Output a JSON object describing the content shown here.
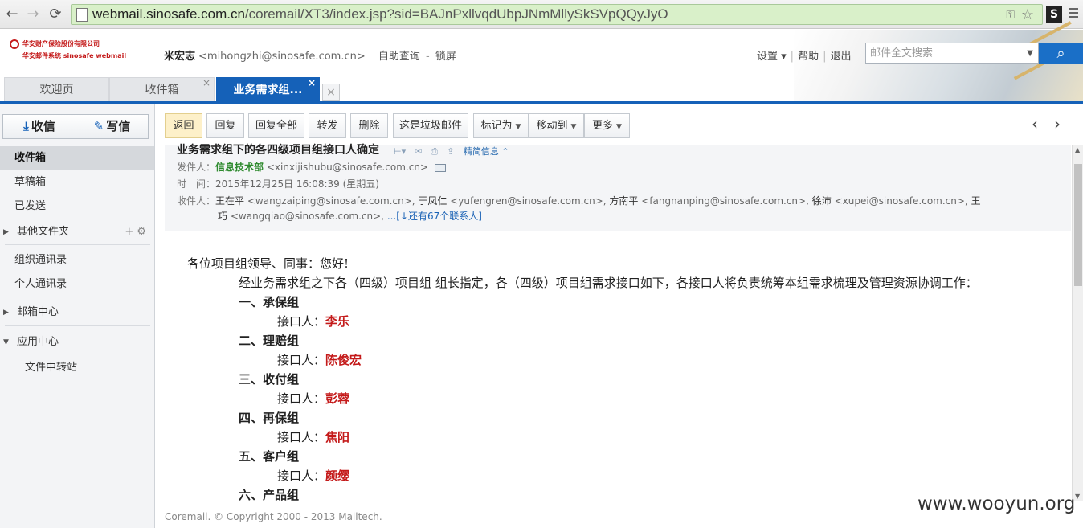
{
  "browser": {
    "url_host": "webmail.sinosafe.com.cn",
    "url_path": "/coremail/XT3/index.jsp?sid=BAJnPxllvqdUbpJNmMllySkSVpQQyJyO",
    "extension_label": "S"
  },
  "header": {
    "logo_line1": "华安财产保险股份有限公司",
    "logo_line2": "华安邮件系统  sinosafe webmail",
    "user_name": "米宏志",
    "user_email": "<mihongzhi@sinosafe.com.cn>",
    "links": [
      "自助查询",
      "锁屏"
    ],
    "link_sep": "-",
    "settings": "设置 ▾",
    "help": "帮助",
    "logout": "退出",
    "search_placeholder": "邮件全文搜索"
  },
  "tabs": [
    {
      "label": "欢迎页"
    },
    {
      "label": "收件箱",
      "close": "×"
    },
    {
      "label": "业务需求组...",
      "close": "×"
    }
  ],
  "tab_close_all": "×",
  "sidebar": {
    "receive": "收信",
    "compose": "写信",
    "items": [
      {
        "label": "收件箱"
      },
      {
        "label": "草稿箱"
      },
      {
        "label": "已发送"
      },
      {
        "label": "其他文件夹"
      },
      {
        "label": "组织通讯录"
      },
      {
        "label": "个人通讯录"
      },
      {
        "label": "邮箱中心"
      },
      {
        "label": "应用中心"
      },
      {
        "label": "文件中转站"
      }
    ],
    "folder_tools": "+  ⚙"
  },
  "toolbar": {
    "back": "返回",
    "reply": "回复",
    "reply_all": "回复全部",
    "forward": "转发",
    "delete": "删除",
    "spam": "这是垃圾邮件",
    "mark_as": "标记为",
    "move_to": "移动到",
    "more": "更多",
    "prev": "‹",
    "next": "›"
  },
  "message": {
    "subject": "业务需求组下的各四级项目组接口人确定",
    "detail_toggle": "精简信息 ⌃",
    "from_label": "发件人：",
    "from_name": "信息技术部",
    "from_addr": "<xinxijishubu@sinosafe.com.cn>",
    "time_label": "时　间：",
    "time": "2015年12月25日 16:08:39 (星期五)",
    "to_label": "收件人：",
    "recipients": [
      {
        "name": "王在平",
        "addr": "<wangzaiping@sinosafe.com.cn>,"
      },
      {
        "name": "于凤仁",
        "addr": "<yufengren@sinosafe.com.cn>,"
      },
      {
        "name": "方南平",
        "addr": "<fangnanping@sinosafe.com.cn>,"
      },
      {
        "name": "徐沛",
        "addr": "<xupei@sinosafe.com.cn>,"
      },
      {
        "name": "王巧",
        "addr": "<wangqiao@sinosafe.com.cn>,"
      }
    ],
    "more_contacts": "...[↓还有67个联系人]"
  },
  "body": {
    "greeting": "各位项目组领导、同事：您好!",
    "intro": "经业务需求组之下各（四级）项目组 组长指定，各（四级）项目组需求接口如下，各接口人将负责统筹本组需求梳理及管理资源协调工作：",
    "contact_label": "接口人：",
    "groups": [
      {
        "title": "一、承保组",
        "contact": "李乐"
      },
      {
        "title": "二、理赔组",
        "contact": "陈俊宏"
      },
      {
        "title": "三、收付组",
        "contact": "彭蓉"
      },
      {
        "title": "四、再保组",
        "contact": "焦阳"
      },
      {
        "title": "五、客户组",
        "contact": "颜缨"
      },
      {
        "title": "六、产品组"
      }
    ]
  },
  "footer": "Coremail. © Copyright 2000 - 2013 Mailtech.",
  "watermark": "www.wooyun.org",
  "colors": {
    "accent": "#1561b8",
    "sender": "#2e8a2e",
    "contact": "#c41a1a"
  }
}
